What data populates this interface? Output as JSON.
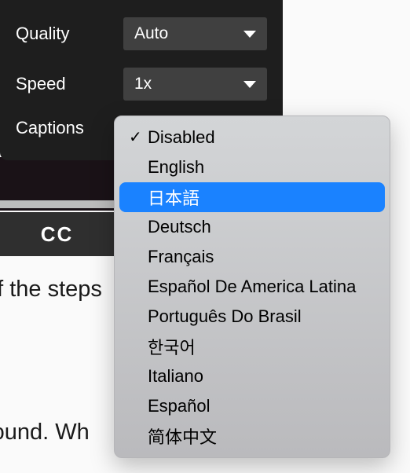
{
  "settings": {
    "quality": {
      "label": "Quality",
      "value": "Auto"
    },
    "speed": {
      "label": "Speed",
      "value": "1x"
    },
    "captions": {
      "label": "Captions"
    }
  },
  "cc_badge": "CC",
  "captions_menu": {
    "items": [
      {
        "label": "Disabled",
        "checked": true,
        "highlighted": false
      },
      {
        "label": "English",
        "checked": false,
        "highlighted": false
      },
      {
        "label": "日本語",
        "checked": false,
        "highlighted": true
      },
      {
        "label": "Deutsch",
        "checked": false,
        "highlighted": false
      },
      {
        "label": "Français",
        "checked": false,
        "highlighted": false
      },
      {
        "label": "Español De America Latina",
        "checked": false,
        "highlighted": false
      },
      {
        "label": "Português Do Brasil",
        "checked": false,
        "highlighted": false
      },
      {
        "label": "한국어",
        "checked": false,
        "highlighted": false
      },
      {
        "label": "Italiano",
        "checked": false,
        "highlighted": false
      },
      {
        "label": "Español",
        "checked": false,
        "highlighted": false
      },
      {
        "label": "简体中文",
        "checked": false,
        "highlighted": false
      }
    ]
  },
  "background_text": {
    "line1": "of the steps",
    "line2": "round. Wh"
  }
}
